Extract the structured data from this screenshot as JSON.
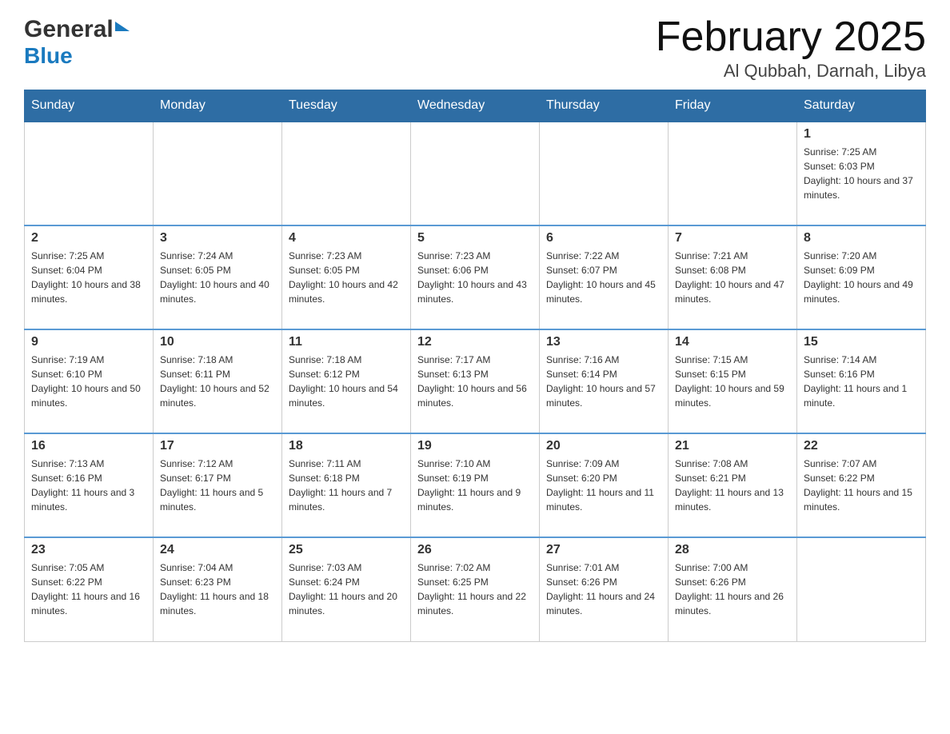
{
  "header": {
    "logo_general": "General",
    "logo_blue": "Blue",
    "month_title": "February 2025",
    "location": "Al Qubbah, Darnah, Libya"
  },
  "days_of_week": [
    "Sunday",
    "Monday",
    "Tuesday",
    "Wednesday",
    "Thursday",
    "Friday",
    "Saturday"
  ],
  "weeks": [
    [
      {
        "day": "",
        "info": ""
      },
      {
        "day": "",
        "info": ""
      },
      {
        "day": "",
        "info": ""
      },
      {
        "day": "",
        "info": ""
      },
      {
        "day": "",
        "info": ""
      },
      {
        "day": "",
        "info": ""
      },
      {
        "day": "1",
        "info": "Sunrise: 7:25 AM\nSunset: 6:03 PM\nDaylight: 10 hours and 37 minutes."
      }
    ],
    [
      {
        "day": "2",
        "info": "Sunrise: 7:25 AM\nSunset: 6:04 PM\nDaylight: 10 hours and 38 minutes."
      },
      {
        "day": "3",
        "info": "Sunrise: 7:24 AM\nSunset: 6:05 PM\nDaylight: 10 hours and 40 minutes."
      },
      {
        "day": "4",
        "info": "Sunrise: 7:23 AM\nSunset: 6:05 PM\nDaylight: 10 hours and 42 minutes."
      },
      {
        "day": "5",
        "info": "Sunrise: 7:23 AM\nSunset: 6:06 PM\nDaylight: 10 hours and 43 minutes."
      },
      {
        "day": "6",
        "info": "Sunrise: 7:22 AM\nSunset: 6:07 PM\nDaylight: 10 hours and 45 minutes."
      },
      {
        "day": "7",
        "info": "Sunrise: 7:21 AM\nSunset: 6:08 PM\nDaylight: 10 hours and 47 minutes."
      },
      {
        "day": "8",
        "info": "Sunrise: 7:20 AM\nSunset: 6:09 PM\nDaylight: 10 hours and 49 minutes."
      }
    ],
    [
      {
        "day": "9",
        "info": "Sunrise: 7:19 AM\nSunset: 6:10 PM\nDaylight: 10 hours and 50 minutes."
      },
      {
        "day": "10",
        "info": "Sunrise: 7:18 AM\nSunset: 6:11 PM\nDaylight: 10 hours and 52 minutes."
      },
      {
        "day": "11",
        "info": "Sunrise: 7:18 AM\nSunset: 6:12 PM\nDaylight: 10 hours and 54 minutes."
      },
      {
        "day": "12",
        "info": "Sunrise: 7:17 AM\nSunset: 6:13 PM\nDaylight: 10 hours and 56 minutes."
      },
      {
        "day": "13",
        "info": "Sunrise: 7:16 AM\nSunset: 6:14 PM\nDaylight: 10 hours and 57 minutes."
      },
      {
        "day": "14",
        "info": "Sunrise: 7:15 AM\nSunset: 6:15 PM\nDaylight: 10 hours and 59 minutes."
      },
      {
        "day": "15",
        "info": "Sunrise: 7:14 AM\nSunset: 6:16 PM\nDaylight: 11 hours and 1 minute."
      }
    ],
    [
      {
        "day": "16",
        "info": "Sunrise: 7:13 AM\nSunset: 6:16 PM\nDaylight: 11 hours and 3 minutes."
      },
      {
        "day": "17",
        "info": "Sunrise: 7:12 AM\nSunset: 6:17 PM\nDaylight: 11 hours and 5 minutes."
      },
      {
        "day": "18",
        "info": "Sunrise: 7:11 AM\nSunset: 6:18 PM\nDaylight: 11 hours and 7 minutes."
      },
      {
        "day": "19",
        "info": "Sunrise: 7:10 AM\nSunset: 6:19 PM\nDaylight: 11 hours and 9 minutes."
      },
      {
        "day": "20",
        "info": "Sunrise: 7:09 AM\nSunset: 6:20 PM\nDaylight: 11 hours and 11 minutes."
      },
      {
        "day": "21",
        "info": "Sunrise: 7:08 AM\nSunset: 6:21 PM\nDaylight: 11 hours and 13 minutes."
      },
      {
        "day": "22",
        "info": "Sunrise: 7:07 AM\nSunset: 6:22 PM\nDaylight: 11 hours and 15 minutes."
      }
    ],
    [
      {
        "day": "23",
        "info": "Sunrise: 7:05 AM\nSunset: 6:22 PM\nDaylight: 11 hours and 16 minutes."
      },
      {
        "day": "24",
        "info": "Sunrise: 7:04 AM\nSunset: 6:23 PM\nDaylight: 11 hours and 18 minutes."
      },
      {
        "day": "25",
        "info": "Sunrise: 7:03 AM\nSunset: 6:24 PM\nDaylight: 11 hours and 20 minutes."
      },
      {
        "day": "26",
        "info": "Sunrise: 7:02 AM\nSunset: 6:25 PM\nDaylight: 11 hours and 22 minutes."
      },
      {
        "day": "27",
        "info": "Sunrise: 7:01 AM\nSunset: 6:26 PM\nDaylight: 11 hours and 24 minutes."
      },
      {
        "day": "28",
        "info": "Sunrise: 7:00 AM\nSunset: 6:26 PM\nDaylight: 11 hours and 26 minutes."
      },
      {
        "day": "",
        "info": ""
      }
    ]
  ]
}
